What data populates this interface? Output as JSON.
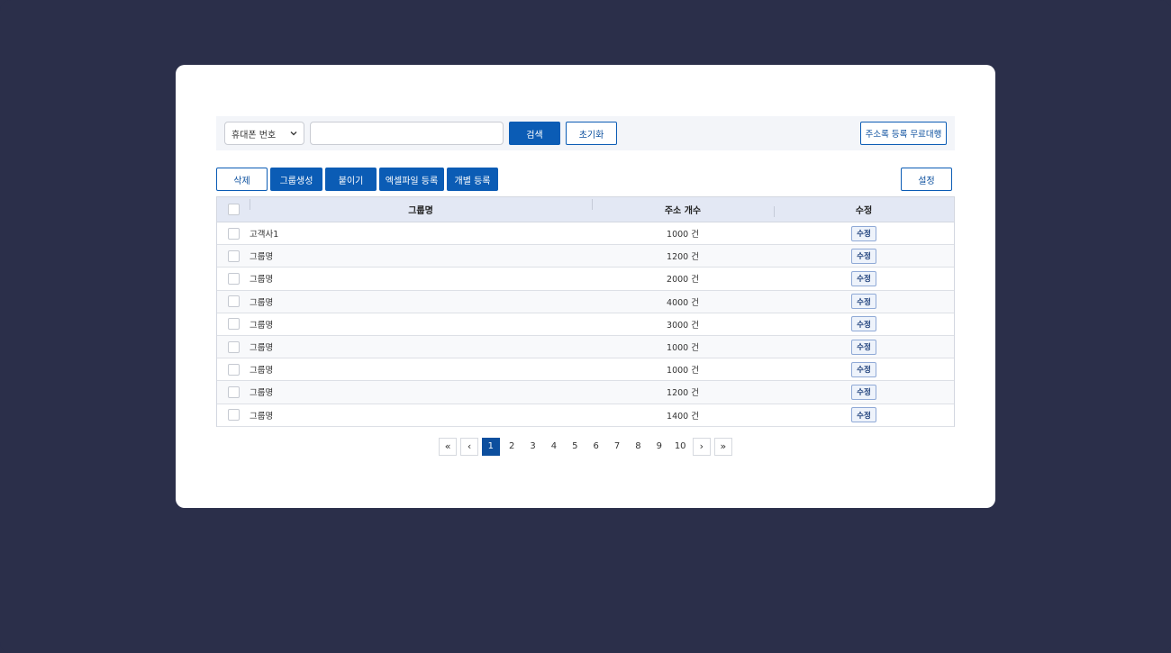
{
  "search": {
    "select_value": "휴대폰 번호",
    "input_value": "",
    "input_placeholder": "",
    "search_label": "검색",
    "reset_label": "초기화",
    "address_service_label": "주소록 등록 무료대행"
  },
  "toolbar": {
    "delete_label": "삭제",
    "create_group_label": "그룹생성",
    "paste_label": "붙이기",
    "excel_label": "엑셀파일 등록",
    "single_label": "개별 등록",
    "settings_label": "설정"
  },
  "table": {
    "headers": {
      "name": "그룹명",
      "count": "주소 개수",
      "edit": "수정"
    },
    "rows": [
      {
        "name": "고객사1",
        "count": "1000 건",
        "edit": "수정"
      },
      {
        "name": "그룹명",
        "count": "1200 건",
        "edit": "수정"
      },
      {
        "name": "그룹명",
        "count": "2000 건",
        "edit": "수정"
      },
      {
        "name": "그룹명",
        "count": "4000 건",
        "edit": "수정"
      },
      {
        "name": "그룹명",
        "count": "3000 건",
        "edit": "수정"
      },
      {
        "name": "그룹명",
        "count": "1000 건",
        "edit": "수정"
      },
      {
        "name": "그룹명",
        "count": "1000 건",
        "edit": "수정"
      },
      {
        "name": "그룹명",
        "count": "1200 건",
        "edit": "수정"
      },
      {
        "name": "그룹명",
        "count": "1400 건",
        "edit": "수정"
      }
    ]
  },
  "pagination": {
    "first": "«",
    "prev": "‹",
    "next": "›",
    "last": "»",
    "pages": [
      "1",
      "2",
      "3",
      "4",
      "5",
      "6",
      "7",
      "8",
      "9",
      "10"
    ],
    "current": "1"
  },
  "colors": {
    "background": "#2b2f4a",
    "primary": "#0b5cb5",
    "active_page": "#0d4f9e",
    "table_header": "#e3e8f4"
  }
}
